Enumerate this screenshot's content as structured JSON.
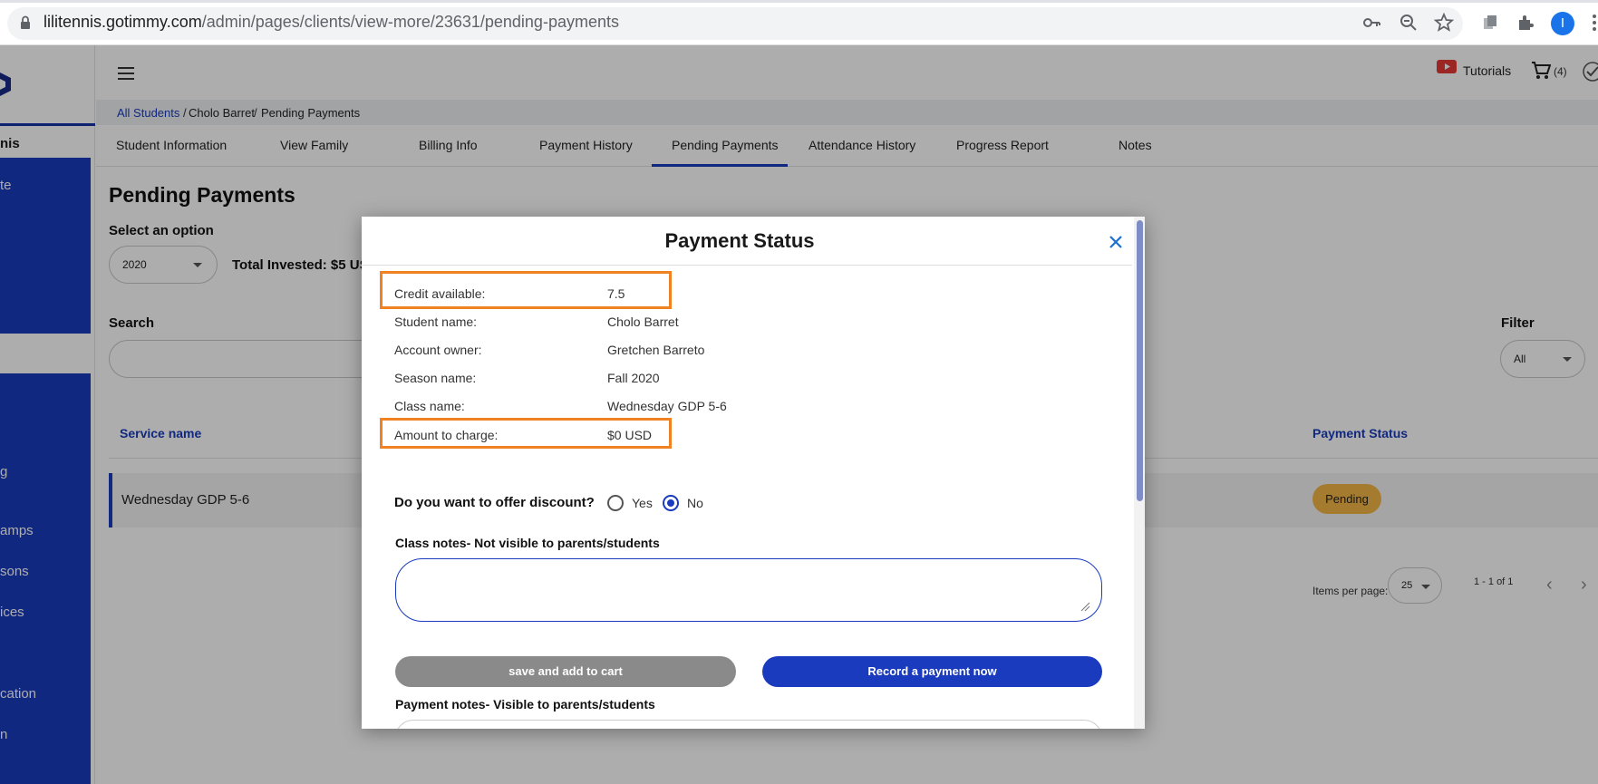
{
  "browser": {
    "url_host": "lilitennis.gotimmy.com",
    "url_path": "/admin/pages/clients/view-more/23631/pending-payments",
    "profile_initial": "I"
  },
  "sidebar": {
    "title": "nis",
    "items": [
      {
        "label": "te"
      },
      {
        "label": "g"
      },
      {
        "label": "amps"
      },
      {
        "label": "sons"
      },
      {
        "label": "ices"
      },
      {
        "label": "cation"
      },
      {
        "label": "n"
      }
    ]
  },
  "topbar": {
    "tutorials_label": "Tutorials",
    "cart_count": "(4)"
  },
  "breadcrumb": {
    "items": [
      "All Students",
      "Cholo Barret",
      "Pending Payments"
    ],
    "separator": "/"
  },
  "tabs": [
    {
      "label": "Student Information"
    },
    {
      "label": "View Family"
    },
    {
      "label": "Billing Info"
    },
    {
      "label": "Payment History"
    },
    {
      "label": "Pending Payments",
      "active": true
    },
    {
      "label": "Attendance History"
    },
    {
      "label": "Progress Report"
    },
    {
      "label": "Notes"
    }
  ],
  "page": {
    "title": "Pending Payments",
    "select_label": "Select an option",
    "year_value": "2020",
    "total_invested": "Total Invested: $5 US",
    "search_label": "Search",
    "filter_label": "Filter",
    "filter_value": "All"
  },
  "table": {
    "columns": [
      "Service name",
      "Payment Status"
    ],
    "rows": [
      {
        "service_name": "Wednesday GDP 5-6",
        "status": "Pending"
      }
    ]
  },
  "pagination": {
    "items_per_page_label": "Items per page:",
    "items_per_page": "25",
    "range": "1 - 1 of 1"
  },
  "modal": {
    "title": "Payment Status",
    "fields": [
      {
        "label": "Credit available:",
        "value": "7.5"
      },
      {
        "label": "Student name:",
        "value": "Cholo Barret"
      },
      {
        "label": "Account owner:",
        "value": "Gretchen Barreto"
      },
      {
        "label": "Season name:",
        "value": "Fall 2020"
      },
      {
        "label": "Class name:",
        "value": "Wednesday GDP 5-6"
      },
      {
        "label": "Amount to charge:",
        "value": "$0 USD"
      }
    ],
    "discount_question": "Do you want to offer discount?",
    "discount_options": [
      "Yes",
      "No"
    ],
    "discount_selected": "No",
    "class_notes_label": "Class notes- Not visible to parents/students",
    "class_notes_value": "",
    "save_button": "save and add to cart",
    "record_button": "Record a payment now",
    "payment_notes_label": "Payment notes- Visible to parents/students"
  },
  "colors": {
    "brand_blue": "#1a3bbd",
    "highlight_orange": "#f08224",
    "pending_badge": "#f4b546"
  }
}
